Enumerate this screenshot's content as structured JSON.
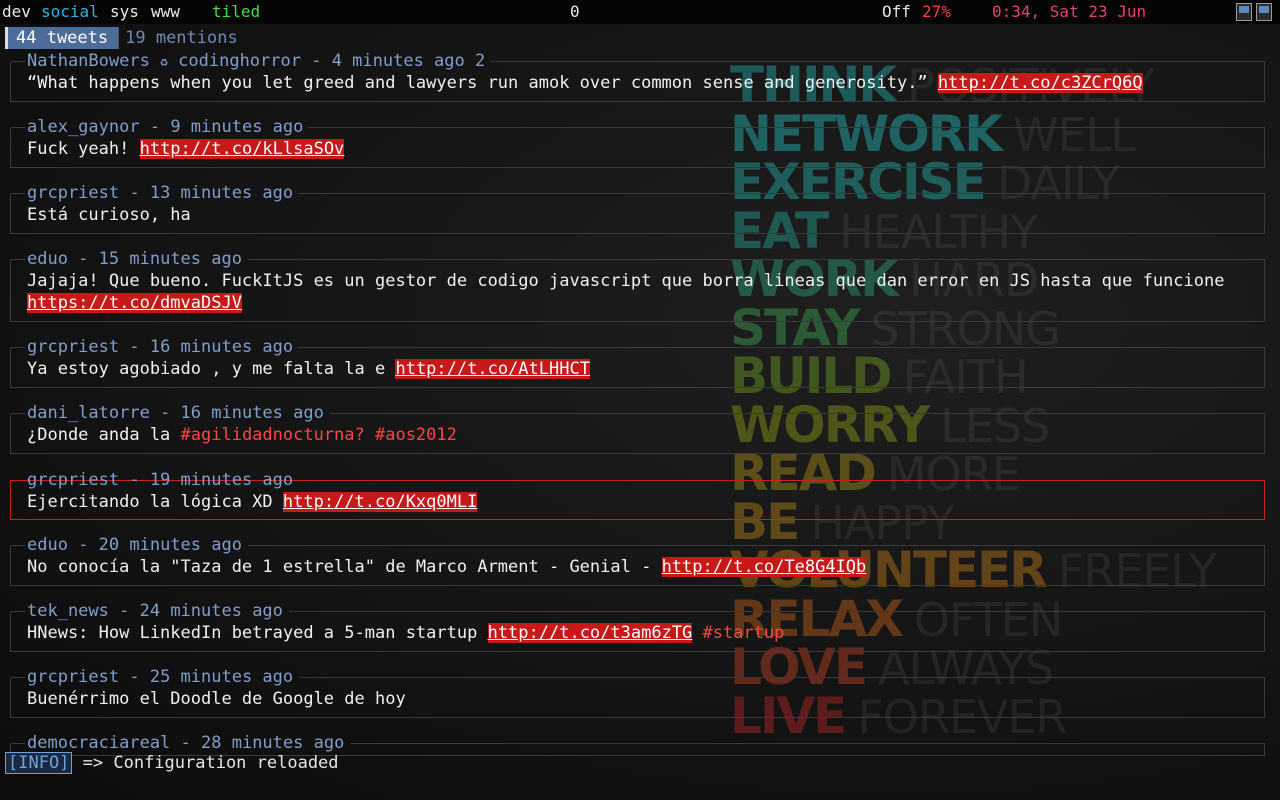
{
  "topbar": {
    "workspaces": [
      "dev",
      "social",
      "sys",
      "www"
    ],
    "layout": "tiled",
    "counter": "0",
    "status_off": "Off",
    "battery": "27%",
    "clock": "0:34, Sat 23 Jun",
    "icons": [
      "computer-icon",
      "document-icon"
    ]
  },
  "tabs": {
    "active": "44 tweets",
    "inactive": "19 mentions"
  },
  "tweets": [
    {
      "user": "NathanBowers",
      "retweet_symbol": "♻",
      "original": "codinghorror",
      "time": "4 minutes ago",
      "count": "2",
      "text": "“What happens when you let greed and lawyers run amok over common sense and generosity.” ",
      "link": "http://t.co/c3ZCrQ6Q",
      "after": ""
    },
    {
      "user": "alex_gaynor",
      "time": "9 minutes ago",
      "text": "Fuck yeah! ",
      "link": "http://t.co/kLlsaSOv",
      "after": ""
    },
    {
      "user": "grcpriest",
      "time": "13 minutes ago",
      "text": "Está curioso, ha",
      "link": "",
      "after": ""
    },
    {
      "user": "eduo",
      "time": "15 minutes ago",
      "text": "Jajaja! Que bueno. FuckItJS es un gestor de codigo javascript que borra lineas que dan error en JS hasta que funcione ",
      "link": "https://t.co/dmvaDSJV",
      "after": ""
    },
    {
      "user": "grcpriest",
      "time": "16 minutes ago",
      "text": "Ya estoy agobiado , y me falta la e ",
      "link": "http://t.co/AtLHHCT",
      "after": ""
    },
    {
      "user": "dani_latorre",
      "time": "16 minutes ago",
      "text": "¿Donde anda la ",
      "link": "",
      "hashtags": "#agilidadnocturna? #aos2012",
      "after": ""
    },
    {
      "user": "grcpriest",
      "time": "19 minutes ago",
      "text": "Ejercitando la lógica XD ",
      "link": "http://t.co/Kxq0MLI",
      "after": "",
      "selected": true
    },
    {
      "user": "eduo",
      "time": "20 minutes ago",
      "text": "No conocía la \"Taza de 1 estrella\" de Marco Arment - Genial - ",
      "link": "http://t.co/Te8G4IQb",
      "after": ""
    },
    {
      "user": "tek_news",
      "time": "24 minutes ago",
      "text": "HNews: How LinkedIn betrayed a 5-man startup ",
      "link": "http://t.co/t3am6zTG",
      "after": " #startup"
    },
    {
      "user": "grcpriest",
      "time": "25 minutes ago",
      "text": "Buenérrimo el Doodle de Google de hoy",
      "link": "",
      "after": ""
    },
    {
      "user": "democraciareal",
      "time": "28 minutes ago",
      "text": "",
      "link": "",
      "after": ""
    }
  ],
  "status": {
    "badge": "[INFO]",
    "message": " => Configuration reloaded"
  },
  "wallpaper": [
    {
      "bold": "THINK",
      "thin": "POSITIVELY",
      "color": "#1d5a5a"
    },
    {
      "bold": "NETWORK",
      "thin": "WELL",
      "color": "#1f6262"
    },
    {
      "bold": "EXERCISE",
      "thin": "DAILY",
      "color": "#1f5e5a"
    },
    {
      "bold": "EAT",
      "thin": "HEALTHY",
      "color": "#1f5a52"
    },
    {
      "bold": "WORK",
      "thin": "HARD",
      "color": "#245a45"
    },
    {
      "bold": "STAY",
      "thin": "STRONG",
      "color": "#2c5a35"
    },
    {
      "bold": "BUILD",
      "thin": "FAITH",
      "color": "#42561f"
    },
    {
      "bold": "WORRY",
      "thin": "LESS",
      "color": "#4f5418"
    },
    {
      "bold": "READ",
      "thin": "MORE",
      "color": "#5a4f18"
    },
    {
      "bold": "BE",
      "thin": "HAPPY",
      "color": "#5e4a18"
    },
    {
      "bold": "VOLUNTEER",
      "thin": "FREELY",
      "color": "#634418"
    },
    {
      "bold": "RELAX",
      "thin": "OFTEN",
      "color": "#633818"
    },
    {
      "bold": "LOVE",
      "thin": "ALWAYS",
      "color": "#612a1a"
    },
    {
      "bold": "LIVE",
      "thin": "FOREVER",
      "color": "#5c1c1c"
    }
  ]
}
